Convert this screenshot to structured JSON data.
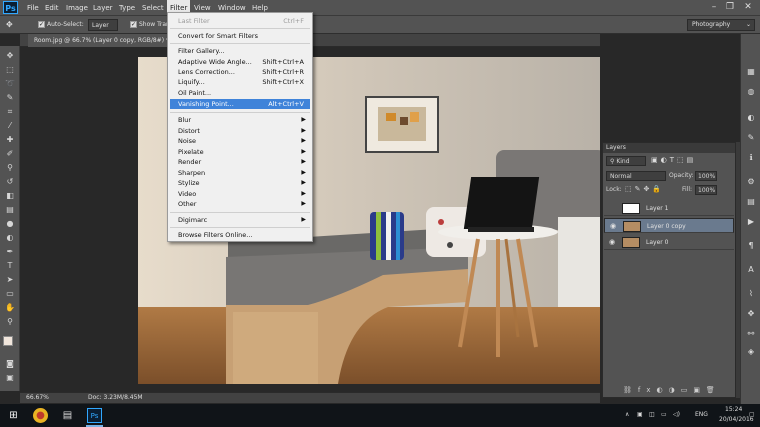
{
  "menubar": {
    "logo": "Ps",
    "items": [
      "File",
      "Edit",
      "Image",
      "Layer",
      "Type",
      "Select",
      "Filter",
      "View",
      "Window",
      "Help"
    ]
  },
  "options": {
    "auto_select": "Auto-Select:",
    "auto_select_value": "Layer",
    "show_transform": "Show Trans",
    "workspace": "Photography"
  },
  "document": {
    "tab_title": "Room.jpg @ 66.7% (Layer 0 copy, RGB/8#) *",
    "zoom": "66.67%",
    "doc_info": "Doc: 3.23M/8.45M"
  },
  "filter_menu": {
    "items": [
      {
        "label": "Last Filter",
        "shortcut": "Ctrl+F",
        "disabled": true
      },
      {
        "label": "Convert for Smart Filters"
      },
      {
        "label": "Filter Gallery..."
      },
      {
        "label": "Adaptive Wide Angle...",
        "shortcut": "Shift+Ctrl+A"
      },
      {
        "label": "Lens Correction...",
        "shortcut": "Shift+Ctrl+R"
      },
      {
        "label": "Liquify...",
        "shortcut": "Shift+Ctrl+X"
      },
      {
        "label": "Oil Paint..."
      },
      {
        "label": "Vanishing Point...",
        "shortcut": "Alt+Ctrl+V",
        "highlighted": true
      },
      {
        "label": "Blur",
        "submenu": true
      },
      {
        "label": "Distort",
        "submenu": true
      },
      {
        "label": "Noise",
        "submenu": true
      },
      {
        "label": "Pixelate",
        "submenu": true
      },
      {
        "label": "Render",
        "submenu": true
      },
      {
        "label": "Sharpen",
        "submenu": true
      },
      {
        "label": "Stylize",
        "submenu": true
      },
      {
        "label": "Video",
        "submenu": true
      },
      {
        "label": "Other",
        "submenu": true
      },
      {
        "label": "Digimarc",
        "submenu": true
      },
      {
        "label": "Browse Filters Online..."
      }
    ]
  },
  "layers_panel": {
    "title": "Layers",
    "kind": "Kind",
    "blend_mode": "Normal",
    "opacity_label": "Opacity:",
    "opacity_value": "100%",
    "lock_label": "Lock:",
    "fill_label": "Fill:",
    "fill_value": "100%",
    "layers": [
      {
        "name": "Layer 1",
        "visible": false,
        "selected": false
      },
      {
        "name": "Layer 0 copy",
        "visible": true,
        "selected": true
      },
      {
        "name": "Layer 0",
        "visible": true,
        "selected": false
      }
    ]
  },
  "taskbar": {
    "language": "ENG",
    "time": "15:24",
    "date": "20/04/2016"
  },
  "colors": {
    "accent": "#3f83d9",
    "panel": "#535353",
    "ps_blue": "#31a8ff"
  }
}
